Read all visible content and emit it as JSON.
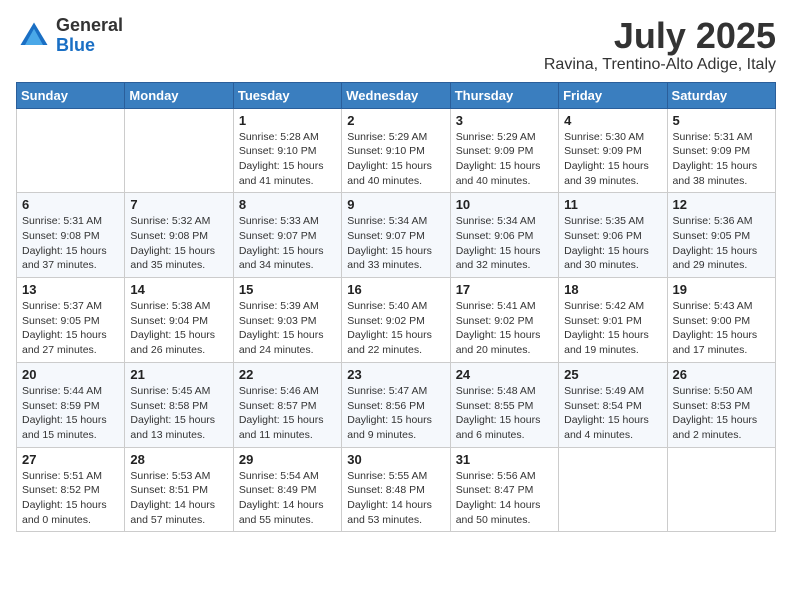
{
  "header": {
    "logo": {
      "general": "General",
      "blue": "Blue"
    },
    "month_year": "July 2025",
    "location": "Ravina, Trentino-Alto Adige, Italy"
  },
  "weekdays": [
    "Sunday",
    "Monday",
    "Tuesday",
    "Wednesday",
    "Thursday",
    "Friday",
    "Saturday"
  ],
  "weeks": [
    [
      {
        "day": "",
        "info": ""
      },
      {
        "day": "",
        "info": ""
      },
      {
        "day": "1",
        "info": "Sunrise: 5:28 AM\nSunset: 9:10 PM\nDaylight: 15 hours and 41 minutes."
      },
      {
        "day": "2",
        "info": "Sunrise: 5:29 AM\nSunset: 9:10 PM\nDaylight: 15 hours and 40 minutes."
      },
      {
        "day": "3",
        "info": "Sunrise: 5:29 AM\nSunset: 9:09 PM\nDaylight: 15 hours and 40 minutes."
      },
      {
        "day": "4",
        "info": "Sunrise: 5:30 AM\nSunset: 9:09 PM\nDaylight: 15 hours and 39 minutes."
      },
      {
        "day": "5",
        "info": "Sunrise: 5:31 AM\nSunset: 9:09 PM\nDaylight: 15 hours and 38 minutes."
      }
    ],
    [
      {
        "day": "6",
        "info": "Sunrise: 5:31 AM\nSunset: 9:08 PM\nDaylight: 15 hours and 37 minutes."
      },
      {
        "day": "7",
        "info": "Sunrise: 5:32 AM\nSunset: 9:08 PM\nDaylight: 15 hours and 35 minutes."
      },
      {
        "day": "8",
        "info": "Sunrise: 5:33 AM\nSunset: 9:07 PM\nDaylight: 15 hours and 34 minutes."
      },
      {
        "day": "9",
        "info": "Sunrise: 5:34 AM\nSunset: 9:07 PM\nDaylight: 15 hours and 33 minutes."
      },
      {
        "day": "10",
        "info": "Sunrise: 5:34 AM\nSunset: 9:06 PM\nDaylight: 15 hours and 32 minutes."
      },
      {
        "day": "11",
        "info": "Sunrise: 5:35 AM\nSunset: 9:06 PM\nDaylight: 15 hours and 30 minutes."
      },
      {
        "day": "12",
        "info": "Sunrise: 5:36 AM\nSunset: 9:05 PM\nDaylight: 15 hours and 29 minutes."
      }
    ],
    [
      {
        "day": "13",
        "info": "Sunrise: 5:37 AM\nSunset: 9:05 PM\nDaylight: 15 hours and 27 minutes."
      },
      {
        "day": "14",
        "info": "Sunrise: 5:38 AM\nSunset: 9:04 PM\nDaylight: 15 hours and 26 minutes."
      },
      {
        "day": "15",
        "info": "Sunrise: 5:39 AM\nSunset: 9:03 PM\nDaylight: 15 hours and 24 minutes."
      },
      {
        "day": "16",
        "info": "Sunrise: 5:40 AM\nSunset: 9:02 PM\nDaylight: 15 hours and 22 minutes."
      },
      {
        "day": "17",
        "info": "Sunrise: 5:41 AM\nSunset: 9:02 PM\nDaylight: 15 hours and 20 minutes."
      },
      {
        "day": "18",
        "info": "Sunrise: 5:42 AM\nSunset: 9:01 PM\nDaylight: 15 hours and 19 minutes."
      },
      {
        "day": "19",
        "info": "Sunrise: 5:43 AM\nSunset: 9:00 PM\nDaylight: 15 hours and 17 minutes."
      }
    ],
    [
      {
        "day": "20",
        "info": "Sunrise: 5:44 AM\nSunset: 8:59 PM\nDaylight: 15 hours and 15 minutes."
      },
      {
        "day": "21",
        "info": "Sunrise: 5:45 AM\nSunset: 8:58 PM\nDaylight: 15 hours and 13 minutes."
      },
      {
        "day": "22",
        "info": "Sunrise: 5:46 AM\nSunset: 8:57 PM\nDaylight: 15 hours and 11 minutes."
      },
      {
        "day": "23",
        "info": "Sunrise: 5:47 AM\nSunset: 8:56 PM\nDaylight: 15 hours and 9 minutes."
      },
      {
        "day": "24",
        "info": "Sunrise: 5:48 AM\nSunset: 8:55 PM\nDaylight: 15 hours and 6 minutes."
      },
      {
        "day": "25",
        "info": "Sunrise: 5:49 AM\nSunset: 8:54 PM\nDaylight: 15 hours and 4 minutes."
      },
      {
        "day": "26",
        "info": "Sunrise: 5:50 AM\nSunset: 8:53 PM\nDaylight: 15 hours and 2 minutes."
      }
    ],
    [
      {
        "day": "27",
        "info": "Sunrise: 5:51 AM\nSunset: 8:52 PM\nDaylight: 15 hours and 0 minutes."
      },
      {
        "day": "28",
        "info": "Sunrise: 5:53 AM\nSunset: 8:51 PM\nDaylight: 14 hours and 57 minutes."
      },
      {
        "day": "29",
        "info": "Sunrise: 5:54 AM\nSunset: 8:49 PM\nDaylight: 14 hours and 55 minutes."
      },
      {
        "day": "30",
        "info": "Sunrise: 5:55 AM\nSunset: 8:48 PM\nDaylight: 14 hours and 53 minutes."
      },
      {
        "day": "31",
        "info": "Sunrise: 5:56 AM\nSunset: 8:47 PM\nDaylight: 14 hours and 50 minutes."
      },
      {
        "day": "",
        "info": ""
      },
      {
        "day": "",
        "info": ""
      }
    ]
  ]
}
